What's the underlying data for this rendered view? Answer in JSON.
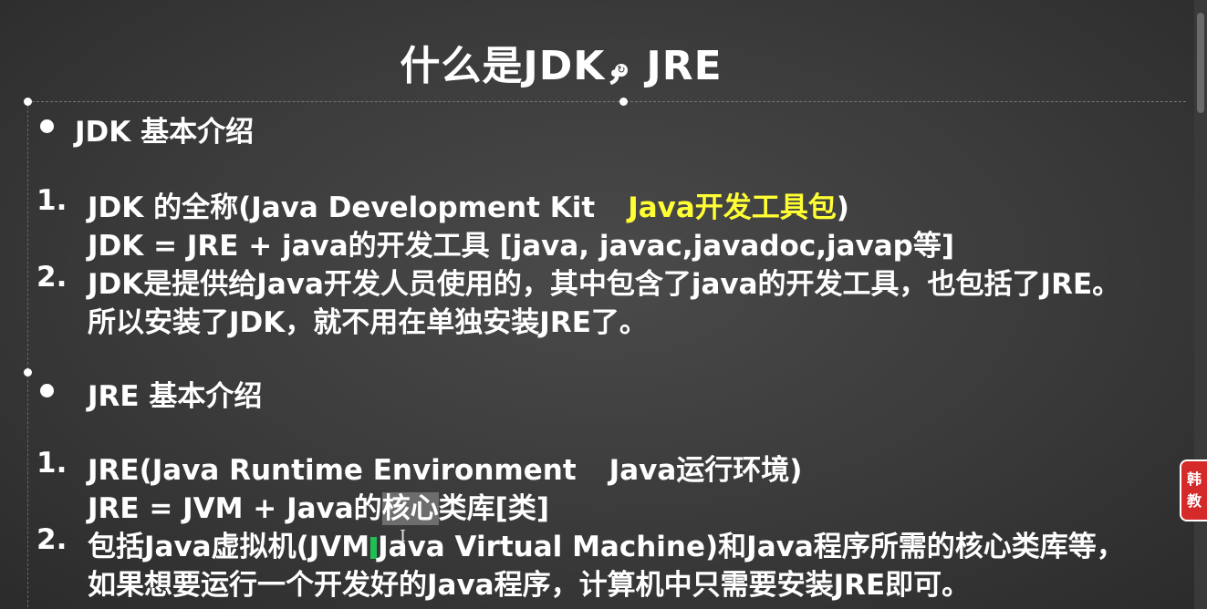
{
  "title": "什么是JDK，JRE",
  "sections": [
    {
      "heading": "JDK 基本介绍",
      "items": [
        {
          "num": "1.",
          "line1_a": "JDK 的全称(Java Development Kit",
          "line1_b": "Java开发工具包",
          "line1_c": ")",
          "line2": "JDK = JRE + java的开发工具 [java, javac,javadoc,javap等]"
        },
        {
          "num": "2.",
          "line1": "JDK是提供给Java开发人员使用的，其中包含了java的开发工具，也包括了JRE。",
          "line2": "所以安装了JDK，就不用在单独安装JRE了。"
        }
      ]
    },
    {
      "heading": "JRE 基本介绍",
      "items": [
        {
          "num": "1.",
          "line1_a": "JRE(Java Runtime Environment",
          "line1_b": "Java运行环境)",
          "line2_a": "JRE = JVM + Java的",
          "line2_b": "核心",
          "line2_c": "类库[类]"
        },
        {
          "num": "2.",
          "line1_a": "包括Java虚拟机(JVM",
          "line1_b": "Java Virtual Machine)和Java程序所需的核心类库等，",
          "line2": "如果想要运行一个开发好的Java程序，计算机中只需要安装JRE即可。"
        }
      ]
    }
  ],
  "side_badge": "韩教",
  "colors": {
    "background": "#3a3a3a",
    "text": "#ffffff",
    "highlight": "#ffff33",
    "badge": "#d42a2a",
    "cursor": "#1fbf55"
  }
}
